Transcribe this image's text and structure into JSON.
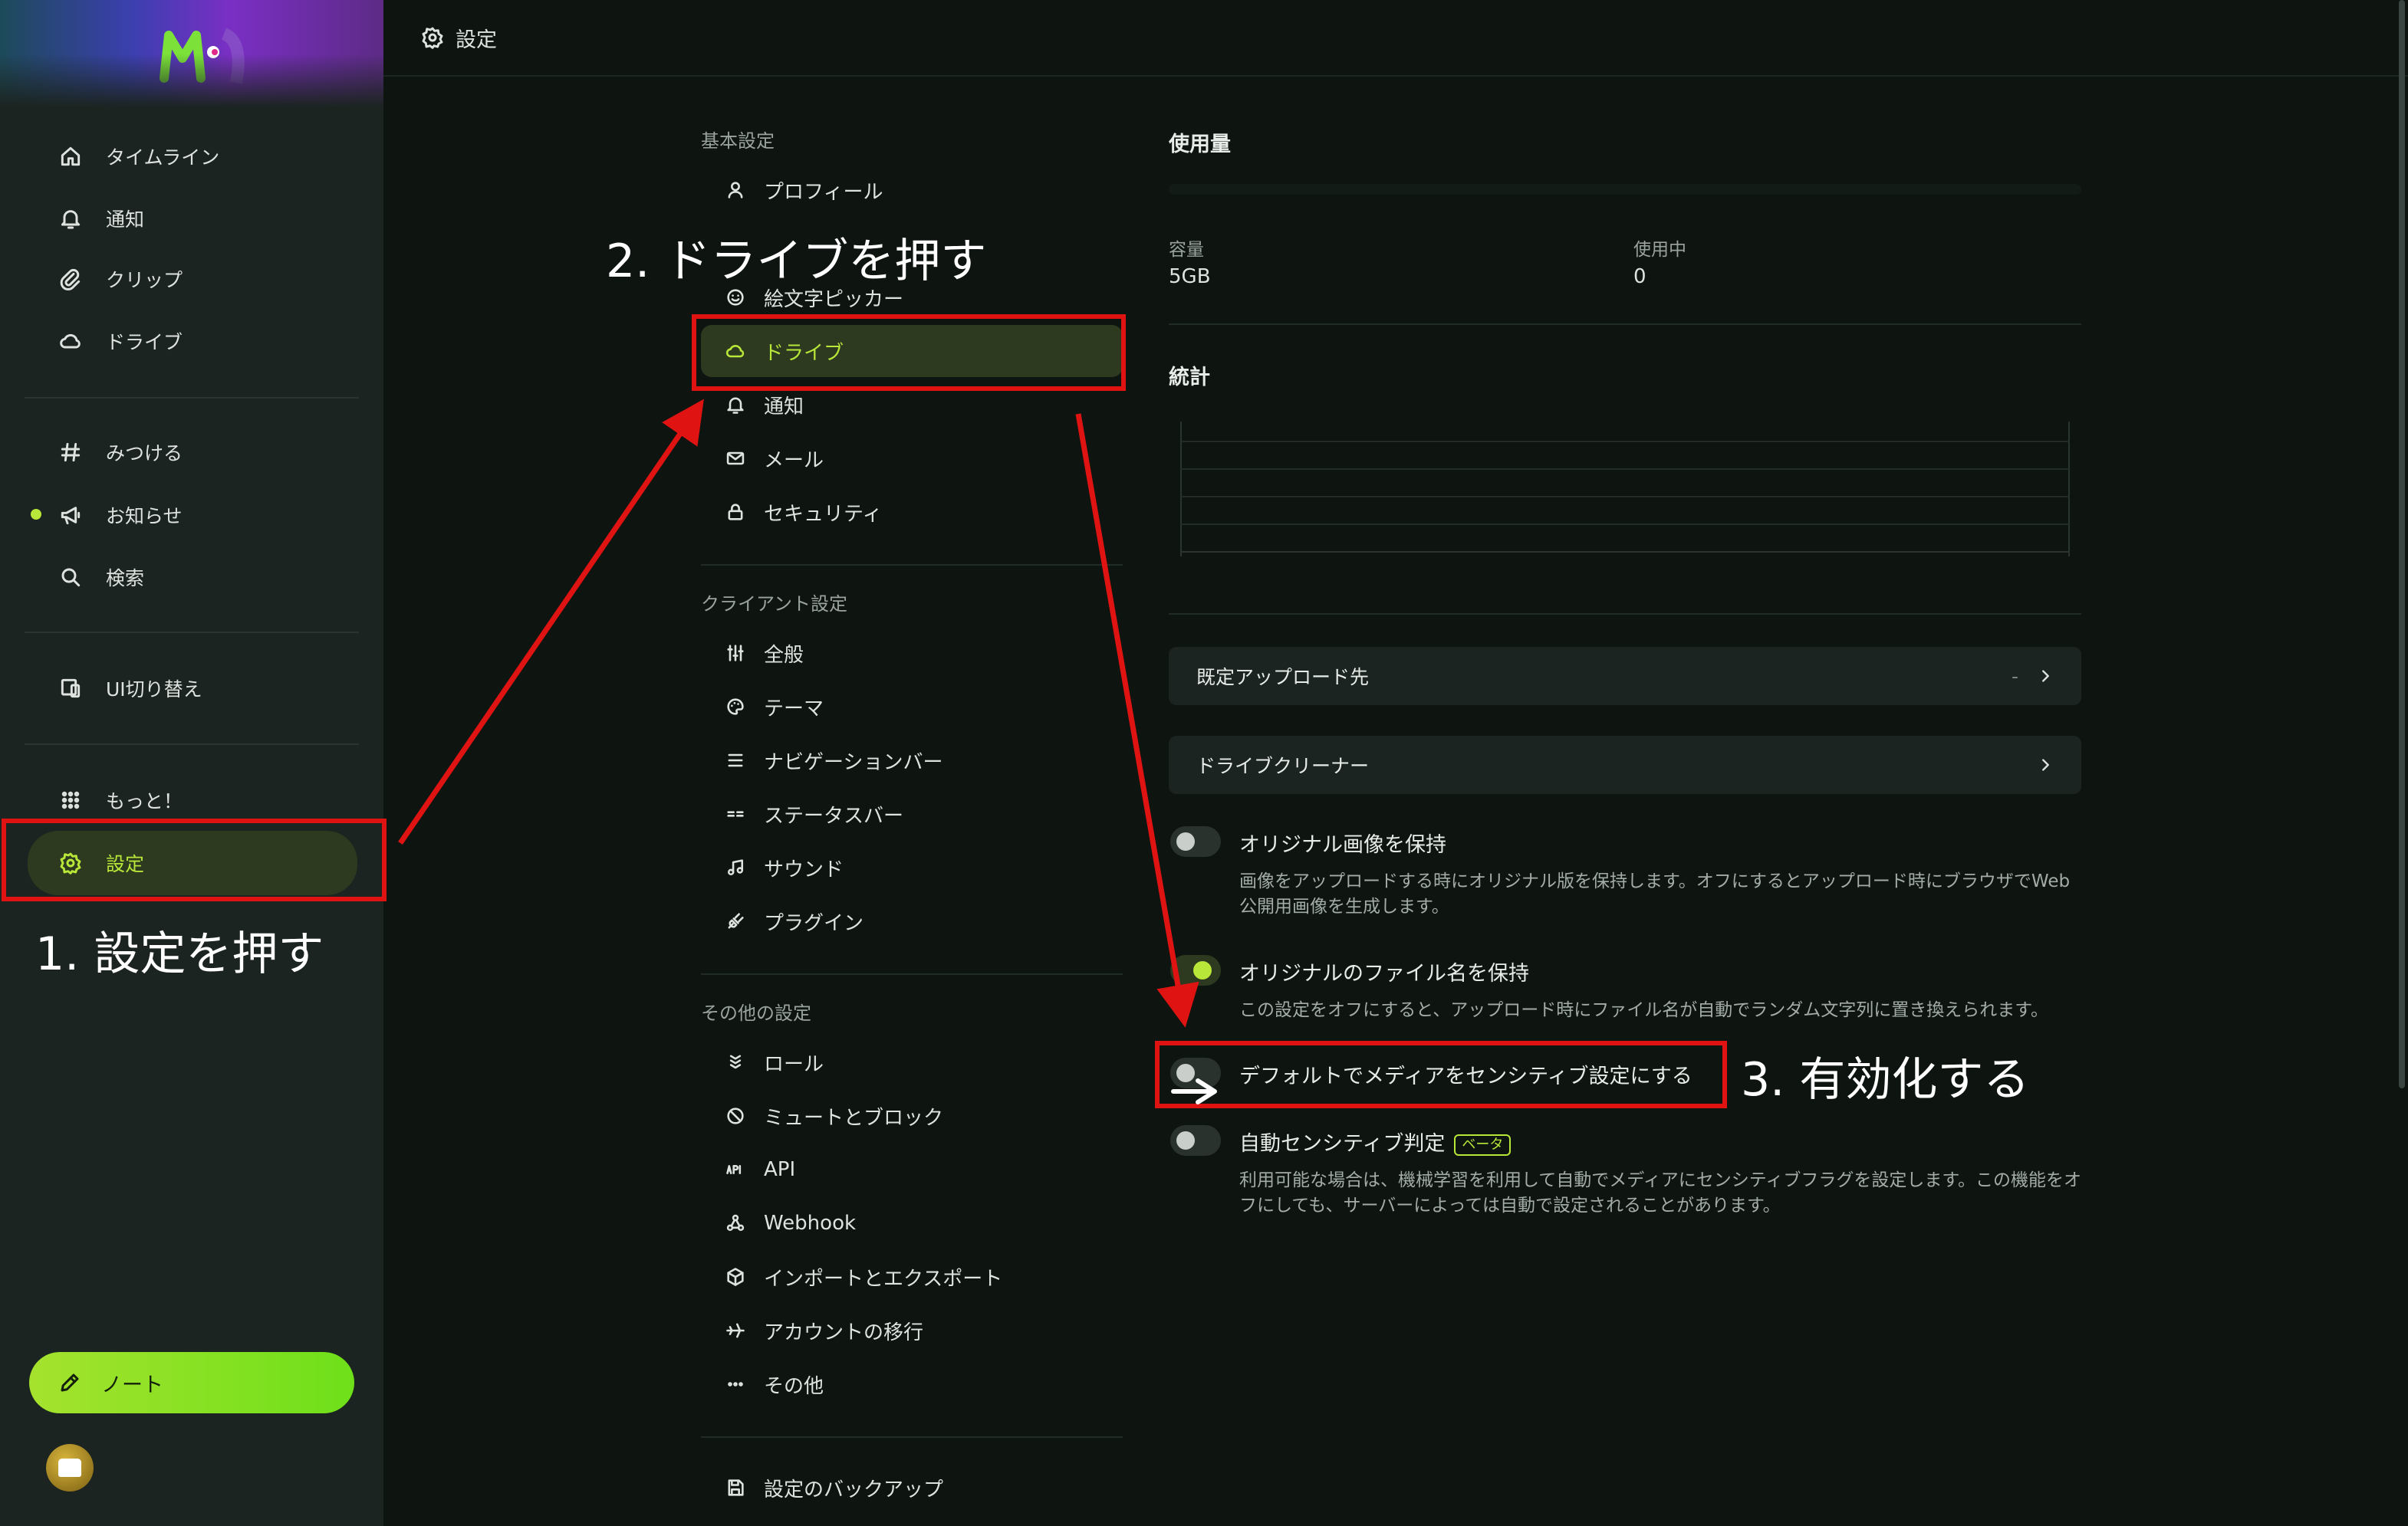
{
  "window": {
    "title": "設定"
  },
  "colors": {
    "accent": "#b8e639",
    "annotation": "#e01313",
    "background": "#0e1511",
    "sidebar": "#1b2420"
  },
  "sidebar": {
    "items": [
      {
        "label": "タイムライン",
        "icon": "home-icon"
      },
      {
        "label": "通知",
        "icon": "bell-icon"
      },
      {
        "label": "クリップ",
        "icon": "paperclip-icon"
      },
      {
        "label": "ドライブ",
        "icon": "cloud-icon"
      },
      {
        "label": "みつける",
        "icon": "hash-icon"
      },
      {
        "label": "お知らせ",
        "icon": "megaphone-icon"
      },
      {
        "label": "検索",
        "icon": "search-icon"
      },
      {
        "label": "UI切り替え",
        "icon": "devices-icon"
      },
      {
        "label": "もっと！",
        "icon": "grid-dots-icon"
      },
      {
        "label": "設定",
        "icon": "gear-icon",
        "active": true
      }
    ],
    "note_button": "ノート"
  },
  "settings_menu": {
    "basic": {
      "title": "基本設定",
      "items": [
        {
          "label": "プロフィール",
          "icon": "user-icon"
        },
        {
          "label": "絵文字ピッカー",
          "icon": "smile-icon"
        },
        {
          "label": "ドライブ",
          "icon": "cloud-icon",
          "active": true
        },
        {
          "label": "通知",
          "icon": "bell-icon"
        },
        {
          "label": "メール",
          "icon": "mail-icon"
        },
        {
          "label": "セキュリティ",
          "icon": "lock-icon"
        }
      ]
    },
    "client": {
      "title": "クライアント設定",
      "items": [
        {
          "label": "全般",
          "icon": "sliders-icon"
        },
        {
          "label": "テーマ",
          "icon": "palette-icon"
        },
        {
          "label": "ナビゲーションバー",
          "icon": "menu-lines-icon"
        },
        {
          "label": "ステータスバー",
          "icon": "status-bars-icon"
        },
        {
          "label": "サウンド",
          "icon": "music-icon"
        },
        {
          "label": "プラグイン",
          "icon": "plug-icon"
        }
      ]
    },
    "other": {
      "title": "その他の設定",
      "items": [
        {
          "label": "ロール",
          "icon": "badges-icon"
        },
        {
          "label": "ミュートとブロック",
          "icon": "ban-icon"
        },
        {
          "label": "API",
          "icon": "api-icon"
        },
        {
          "label": "Webhook",
          "icon": "webhook-icon"
        },
        {
          "label": "インポートとエクスポート",
          "icon": "package-icon"
        },
        {
          "label": "アカウントの移行",
          "icon": "plane-icon"
        },
        {
          "label": "その他",
          "icon": "dots-icon"
        }
      ]
    },
    "backup": {
      "label": "設定のバックアップ",
      "icon": "save-icon"
    }
  },
  "drive_panel": {
    "usage": {
      "title": "使用量",
      "capacity_label": "容量",
      "capacity_value": "5GB",
      "used_label": "使用中",
      "used_value": "0"
    },
    "stats": {
      "title": "統計"
    },
    "default_upload": {
      "label": "既定アップロード先",
      "value": "-"
    },
    "cleaner": {
      "label": "ドライブクリーナー"
    },
    "options": [
      {
        "title": "オリジナル画像を保持",
        "desc": "画像をアップロードする時にオリジナル版を保持します。オフにするとアップロード時にブラウザでWeb公開用画像を生成します。",
        "on": false
      },
      {
        "title": "オリジナルのファイル名を保持",
        "desc": "この設定をオフにすると、アップロード時にファイル名が自動でランダム文字列に置き換えられます。",
        "on": true
      },
      {
        "title": "デフォルトでメディアをセンシティブ設定にする",
        "desc": "",
        "on": false
      },
      {
        "title": "自動センシティブ判定",
        "badge": "ベータ",
        "desc": "利用可能な場合は、機械学習を利用して自動でメディアにセンシティブフラグを設定します。この機能をオフにしても、サーバーによっては自動で設定されることがあります。",
        "on": false
      }
    ]
  },
  "annotations": {
    "step1": "1. 設定を押す",
    "step2": "2. ドライブを押す",
    "step3": "3. 有効化する"
  }
}
